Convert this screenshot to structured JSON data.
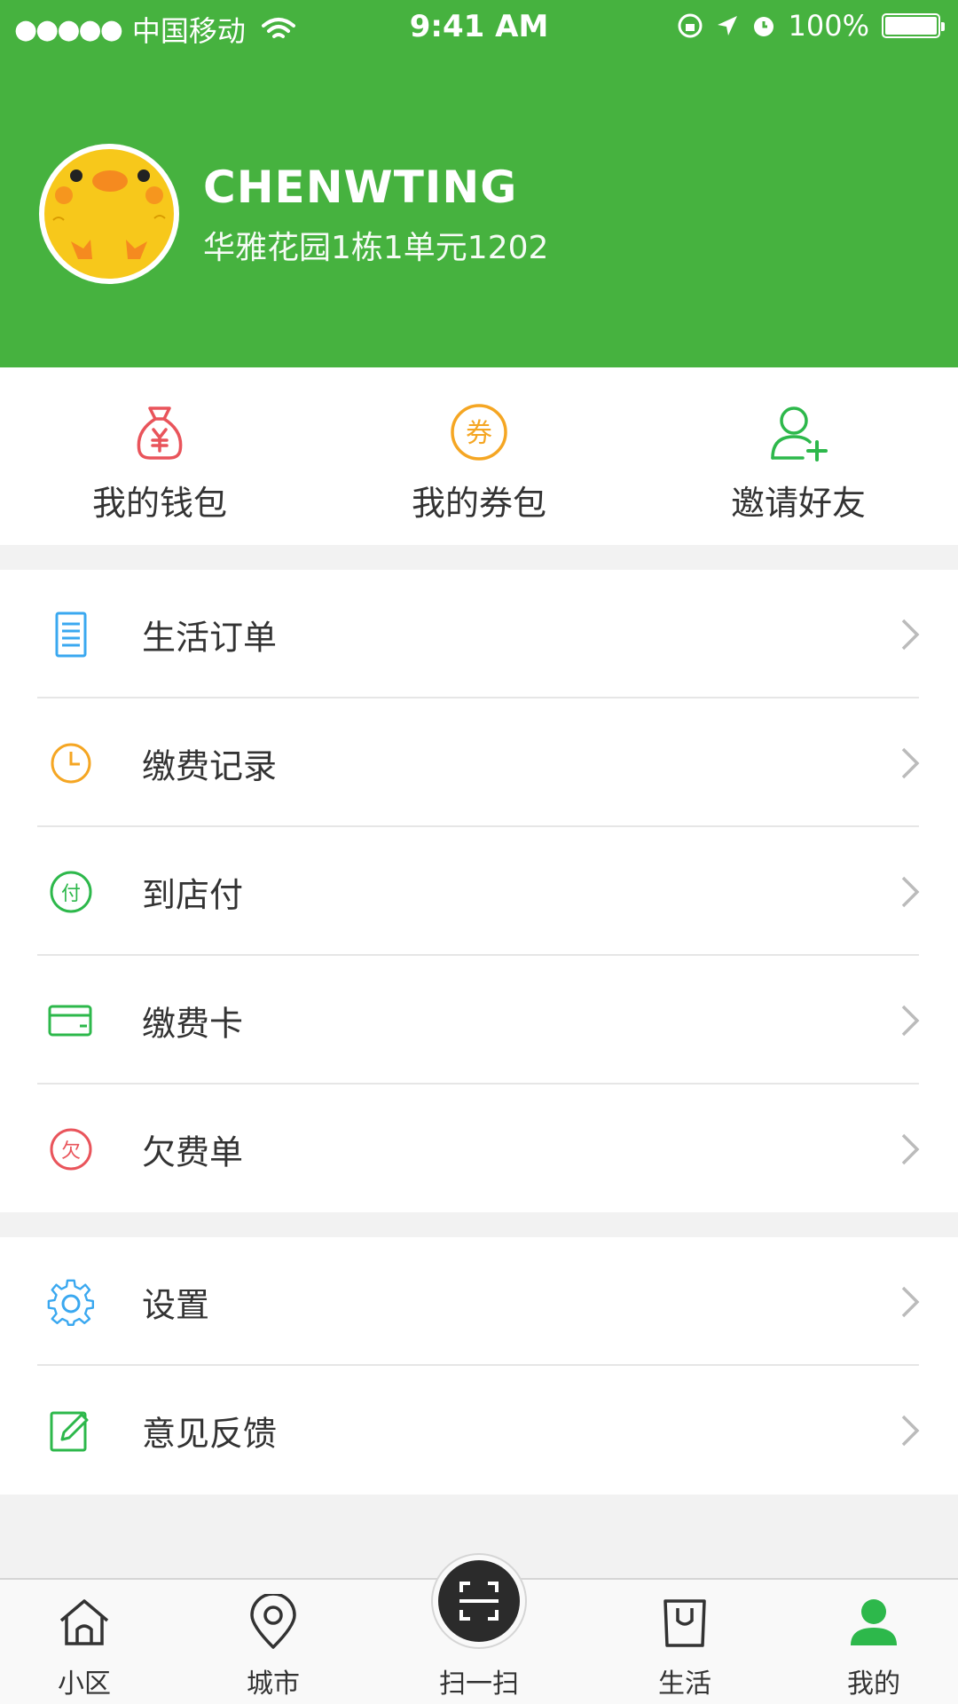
{
  "status_bar": {
    "signal_dots": "●●●●●",
    "carrier": "中国移动",
    "time": "9:41 AM",
    "battery": "100%"
  },
  "profile": {
    "name": "CHENWTING",
    "address": "华雅花园1栋1单元1202"
  },
  "quick_actions": [
    {
      "label": "我的钱包",
      "icon": "money-bag-icon",
      "color": "#e9545b"
    },
    {
      "label": "我的券包",
      "icon": "coupon-icon",
      "color": "#f5a623"
    },
    {
      "label": "邀请好友",
      "icon": "add-friend-icon",
      "color": "#2db84b"
    }
  ],
  "menu_group_1": [
    {
      "label": "生活订单",
      "icon": "order-list-icon",
      "color": "#3aa8f0"
    },
    {
      "label": "缴费记录",
      "icon": "clock-icon",
      "color": "#f5a623"
    },
    {
      "label": "到店付",
      "icon": "pay-icon",
      "glyph": "付",
      "color": "#2db84b"
    },
    {
      "label": "缴费卡",
      "icon": "card-icon",
      "color": "#2db84b"
    },
    {
      "label": "欠费单",
      "icon": "arrears-icon",
      "glyph": "欠",
      "color": "#e9545b"
    }
  ],
  "menu_group_2": [
    {
      "label": "设置",
      "icon": "gear-icon",
      "color": "#3aa8f0"
    },
    {
      "label": "意见反馈",
      "icon": "edit-icon",
      "color": "#2db84b"
    }
  ],
  "coupon_glyph": "券",
  "tabbar": [
    {
      "label": "小区",
      "icon": "home-icon"
    },
    {
      "label": "城市",
      "icon": "location-icon"
    },
    {
      "label": "扫一扫",
      "icon": "scan-icon"
    },
    {
      "label": "生活",
      "icon": "shopping-bag-icon"
    },
    {
      "label": "我的",
      "icon": "user-icon",
      "active": true
    }
  ],
  "colors": {
    "brand_green": "#46b23f",
    "active_tab": "#2db84b",
    "background": "#f2f2f2"
  }
}
